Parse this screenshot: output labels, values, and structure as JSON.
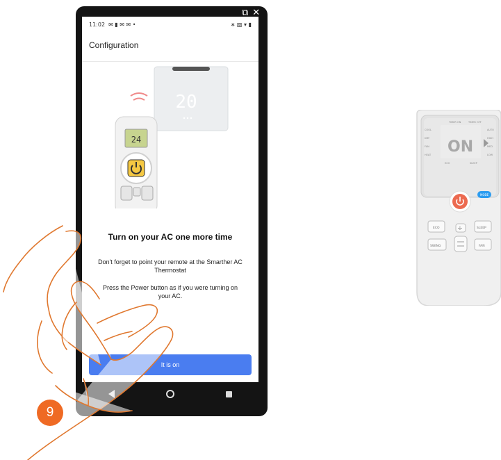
{
  "window": {
    "icons": [
      "external-link-icon",
      "close-icon"
    ],
    "external_glyph": "⧉",
    "close_glyph": "✕"
  },
  "status_bar": {
    "time": "11:02",
    "left_icons": "✉ ▮ ✉ ✉ •",
    "right_icons": "∗ ▧ ▾ ▮"
  },
  "app_bar": {
    "title": "Configuration"
  },
  "illustration": {
    "thermostat_display": "20",
    "remote_display": "24"
  },
  "content": {
    "heading": "Turn on your AC one more time",
    "paragraph1": "Don't forget to point your remote at the Smarther AC Thermostat",
    "paragraph2": "Press the Power button as if you were turning on your AC."
  },
  "button": {
    "label": "It is on"
  },
  "step_badge": {
    "number": "9"
  },
  "remote": {
    "timer_on": "TIMER ON",
    "timer_off": "TIMER OFF",
    "modes_left": [
      "COOL",
      "DRY",
      "FAN",
      "HEAT"
    ],
    "modes_right": [
      "AUTO",
      "HIGH",
      "MED",
      "LOW"
    ],
    "display": "ON",
    "eco_indicator": "ECO",
    "sleep_indicator": "SLEEP",
    "mode_button": "MODE",
    "eco_button": "ECO",
    "sleep_button": "SLEEP",
    "swing_button": "SWING",
    "fan_button": "FAN"
  },
  "colors": {
    "accent": "#4a7df0",
    "badge": "#ef6a24",
    "power": "#ec6a50",
    "mode": "#2c9cf0"
  }
}
